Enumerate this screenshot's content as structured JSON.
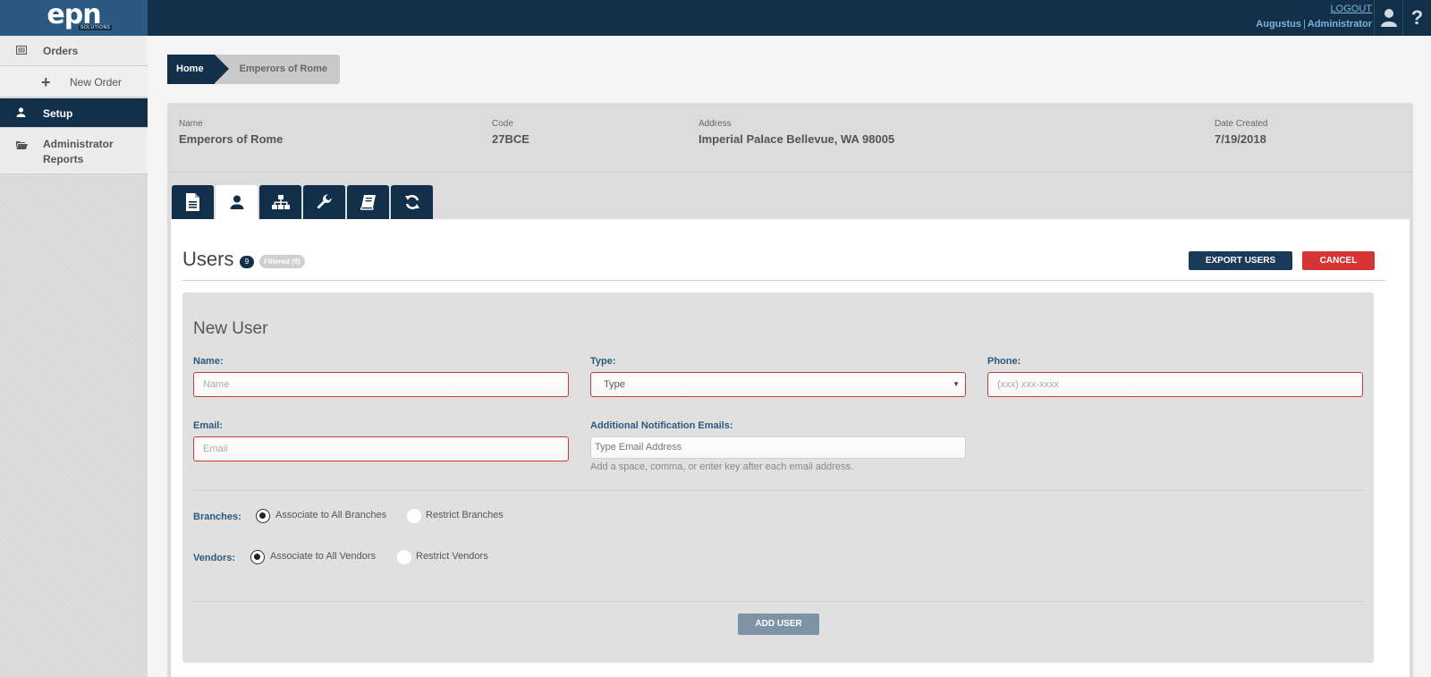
{
  "app": {
    "logo_text": "epn",
    "logo_sub": "SOLUTIONS"
  },
  "header": {
    "logout": "LOGOUT",
    "user_name": "Augustus",
    "separator": "|",
    "role": "Administrator"
  },
  "sidebar": {
    "items": [
      {
        "label": "Orders",
        "icon": "orders-list-icon"
      },
      {
        "label": "New Order",
        "icon": "plus-icon"
      },
      {
        "label": "Setup",
        "icon": "user-icon"
      },
      {
        "label": "Administrator Reports",
        "icon": "folder-open-icon"
      }
    ]
  },
  "breadcrumb": {
    "home": "Home",
    "current": "Emperors of Rome"
  },
  "account": {
    "name_label": "Name",
    "name_value": "Emperors of Rome",
    "code_label": "Code",
    "code_value": "27BCE",
    "address_label": "Address",
    "address_value": "Imperial Palace Bellevue, WA 98005",
    "date_label": "Date Created",
    "date_value": "7/19/2018"
  },
  "tabs": [
    {
      "icon": "document-icon",
      "active": false
    },
    {
      "icon": "user-icon",
      "active": true
    },
    {
      "icon": "sitemap-icon",
      "active": false
    },
    {
      "icon": "wrench-icon",
      "active": false
    },
    {
      "icon": "book-icon",
      "active": false
    },
    {
      "icon": "refresh-icon",
      "active": false
    }
  ],
  "users": {
    "title": "Users",
    "count": "9",
    "filtered": "Filtered (9)",
    "export_label": "EXPORT USERS",
    "cancel_label": "CANCEL"
  },
  "form": {
    "title": "New User",
    "name_label": "Name:",
    "name_placeholder": "Name",
    "type_label": "Type:",
    "type_value": "Type",
    "phone_label": "Phone:",
    "phone_placeholder": "(xxx) xxx-xxxx",
    "email_label": "Email:",
    "email_placeholder": "Email",
    "notify_label": "Additional Notification Emails:",
    "notify_placeholder": "Type Email Address",
    "notify_hint": "Add a space, comma, or enter key after each email address.",
    "branches_label": "Branches:",
    "branches_opt1": "Associate to All Branches",
    "branches_opt2": "Restrict Branches",
    "vendors_label": "Vendors:",
    "vendors_opt1": "Associate to All Vendors",
    "vendors_opt2": "Restrict Vendors",
    "add_label": "ADD USER"
  },
  "colors": {
    "navy": "#123049",
    "logo_blue": "#2a5a82",
    "danger": "#d73535",
    "label_blue": "#2b5a7e"
  }
}
